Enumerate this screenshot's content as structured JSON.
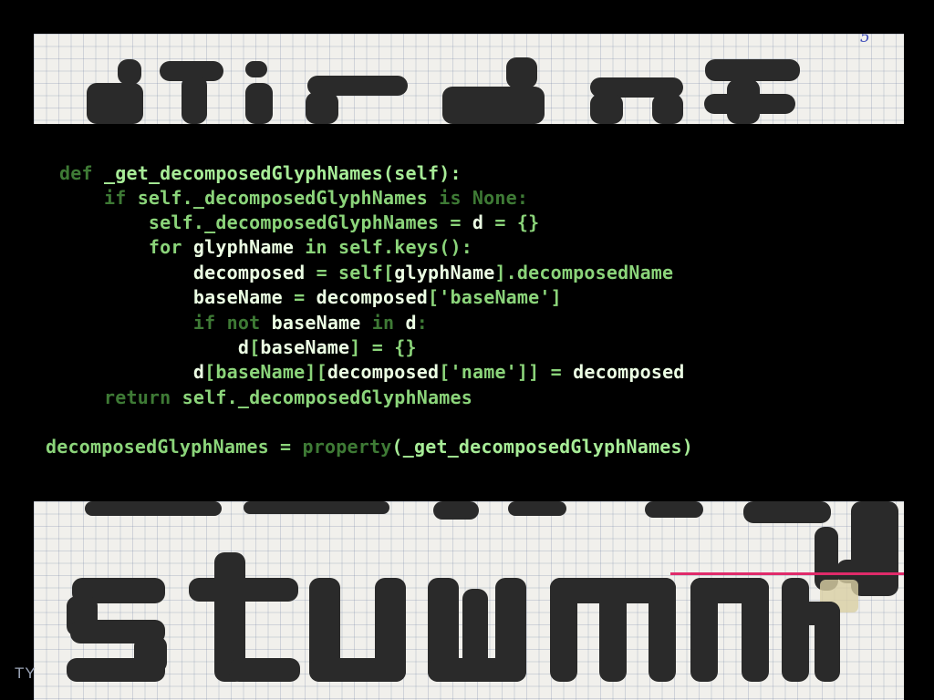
{
  "slide": {
    "background_color": "#000000",
    "paper_color": "#f1f0ec",
    "ink_color": "#2a2a2a",
    "code_color": "#8bd47a",
    "code_highlight_color": "#ecffe4",
    "code_dim_color": "#3e7a35"
  },
  "photo": {
    "corner_mark": "5"
  },
  "code": {
    "l1": {
      "t0": "def",
      "t1": " _get_decomposedGlyphNames(self):"
    },
    "l2": {
      "t0": "    ",
      "t1": "if",
      "t2": " self._decomposedGlyphNames ",
      "t3": "is None",
      "t4": ":"
    },
    "l3": {
      "t0": "        self._decomposedGlyphNames = ",
      "t1": "d",
      "t2": " = {}"
    },
    "l4": {
      "t0": "        for ",
      "t1": "glyphName",
      "t2": " in self.keys():"
    },
    "l5": {
      "t0": "            ",
      "t1": "decomposed",
      "t2": " = self[",
      "t3": "glyphName",
      "t4": "].decomposedName"
    },
    "l6": {
      "t0": "            ",
      "t1": "baseName",
      "t2": " = ",
      "t3": "decomposed",
      "t4": "['baseName']"
    },
    "l7": {
      "t0": "            ",
      "t1": "if not",
      "t2": " ",
      "t3": "baseName",
      "t4": " in ",
      "t5": "d",
      "t6": ":"
    },
    "l8": {
      "t0": "                ",
      "t1": "d",
      "t2": "[",
      "t3": "baseName",
      "t4": "] = {}"
    },
    "l9": {
      "t0": "            ",
      "t1": "d",
      "t2": "[baseName][",
      "t3": "decomposed",
      "t4": "['name']] = ",
      "t5": "decomposed"
    },
    "l10": {
      "t0": "    ",
      "t1": "return",
      "t2": " self._decomposedGlyphNames"
    },
    "l11": {
      "t0": "decomposedGlyphNames = ",
      "t1": "property",
      "t2": "(_get_decomposedGlyphNames)"
    }
  },
  "footer": {
    "text": "TY"
  }
}
